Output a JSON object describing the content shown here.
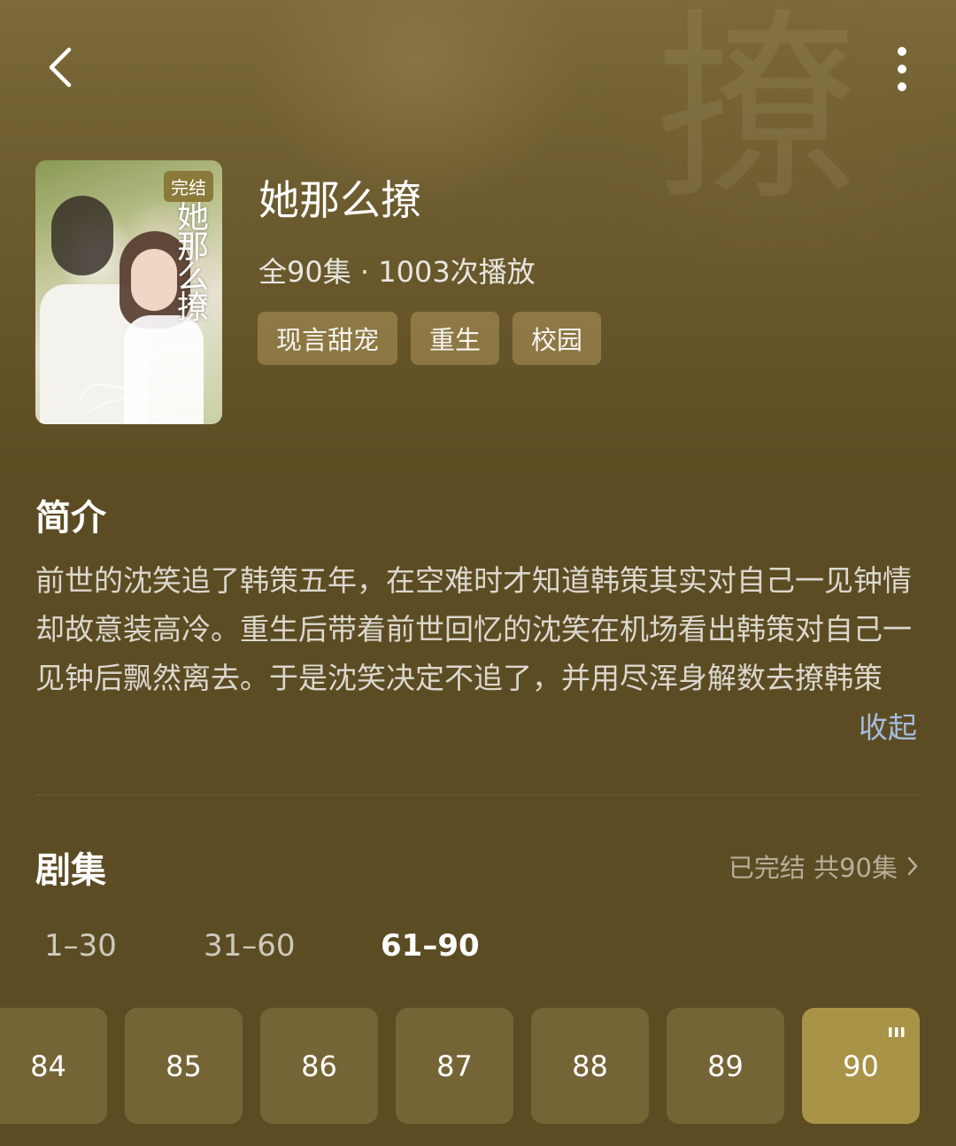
{
  "poster": {
    "badge": "完结",
    "title_art": "她那么撩"
  },
  "drama": {
    "title": "她那么撩",
    "meta": "全90集 · 1003次播放",
    "tags": [
      "现言甜宠",
      "重生",
      "校园"
    ]
  },
  "synopsis": {
    "heading": "简介",
    "text": "前世的沈笑追了韩策五年，在空难时才知道韩策其实对自己一见钟情却故意装高冷。重生后带着前世回忆的沈笑在机场看出韩策对自己一见钟后飘然离去。于是沈笑决定不追了，并用尽浑身解数去撩韩策",
    "collapse_label": "收起"
  },
  "episodes": {
    "heading": "剧集",
    "status": "已完结 共90集",
    "ranges": [
      "1–30",
      "31–60",
      "61–90"
    ],
    "active_range": "61–90",
    "items": [
      "84",
      "85",
      "86",
      "87",
      "88",
      "89",
      "90"
    ],
    "current": "90"
  },
  "icons": {
    "back": "chevron-left-icon",
    "more": "more-vertical-icon",
    "status_arrow": "chevron-right-icon",
    "playing": "playing-bars-icon"
  },
  "colors": {
    "background": "#5c4c23",
    "tag_bg": "#8f7d4a",
    "active_episode": "#a99346",
    "link": "#a6bde0"
  }
}
